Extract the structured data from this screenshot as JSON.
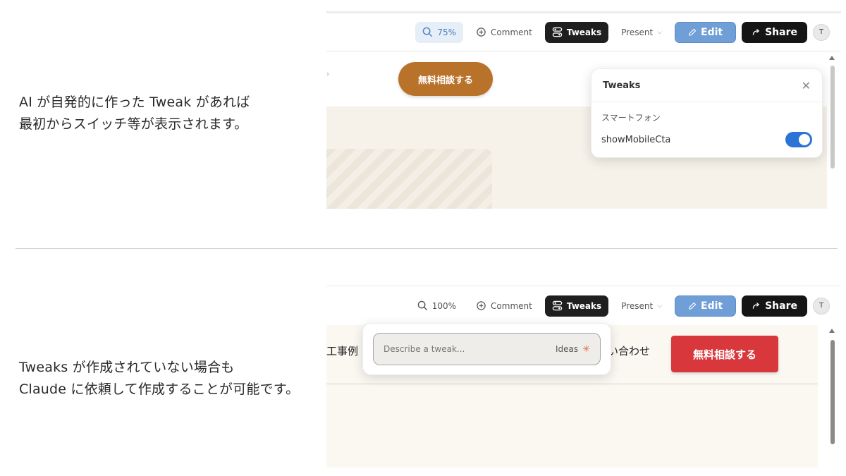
{
  "captions": {
    "top_line1": "AI が自発的に作った Tweak があれば",
    "top_line2": "最初からスイッチ等が表示されます。",
    "bottom_line1": "Tweaks が作成されていない場合も",
    "bottom_line2": "Claude に依頼して作成することが可能です。"
  },
  "top_shot": {
    "toolbar": {
      "zoom": "75%",
      "comment": "Comment",
      "tweaks": "Tweaks",
      "present": "Present",
      "edit": "Edit",
      "share": "Share",
      "avatar": "T"
    },
    "cta": "無料相談する",
    "tweaks_panel": {
      "title": "Tweaks",
      "section": "スマートフォン",
      "toggle_label": "showMobileCta",
      "toggle_on": true
    }
  },
  "bottom_shot": {
    "toolbar": {
      "zoom": "100%",
      "comment": "Comment",
      "tweaks": "Tweaks",
      "present": "Present",
      "edit": "Edit",
      "share": "Share",
      "avatar": "T"
    },
    "nav_left": "工事例",
    "nav_right": "い合わせ",
    "cta": "無料相談する",
    "describe": {
      "placeholder": "Describe a tweak...",
      "ideas": "Ideas"
    }
  },
  "colors": {
    "accent_blue": "#6f9fd6",
    "toggle_blue": "#2c73d6",
    "cta_brown": "#b9722a",
    "cta_red": "#d8383c"
  }
}
